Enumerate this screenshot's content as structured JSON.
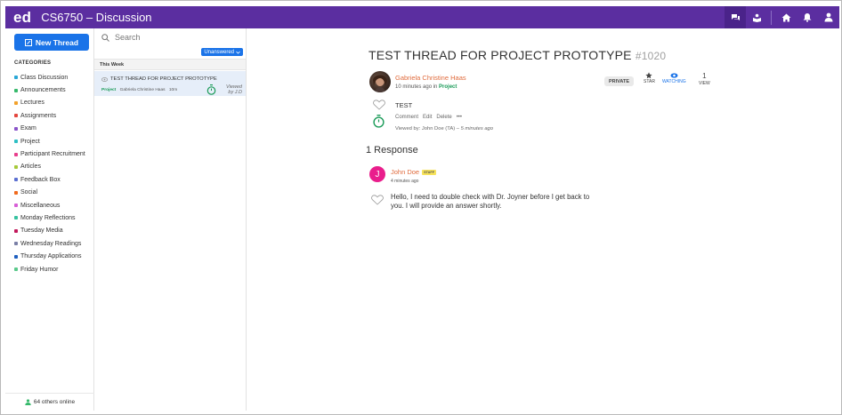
{
  "app": {
    "logo": "ed",
    "course_title": "CS6750 – Discussion"
  },
  "topbar_icons": [
    "discussion-icon",
    "lessons-icon",
    "home-icon",
    "notifications-icon",
    "account-icon"
  ],
  "sidebar": {
    "new_thread_label": "New Thread",
    "categories_heading": "CATEGORIES",
    "categories": [
      {
        "label": "Class Discussion",
        "color": "#2aa7d6"
      },
      {
        "label": "Announcements",
        "color": "#36b96b"
      },
      {
        "label": "Lectures",
        "color": "#f2a12b"
      },
      {
        "label": "Assignments",
        "color": "#e4463d"
      },
      {
        "label": "Exam",
        "color": "#8a54c9"
      },
      {
        "label": "Project",
        "color": "#2ebfc4"
      },
      {
        "label": "Participant Recruitment",
        "color": "#e83e8c"
      },
      {
        "label": "Articles",
        "color": "#a6c93a"
      },
      {
        "label": "Feedback Box",
        "color": "#5b6fd1"
      },
      {
        "label": "Social",
        "color": "#f06a1d"
      },
      {
        "label": "Miscellaneous",
        "color": "#d75fd6"
      },
      {
        "label": "Monday Reflections",
        "color": "#36c2a0"
      },
      {
        "label": "Tuesday Media",
        "color": "#c2185b"
      },
      {
        "label": "Wednesday Readings",
        "color": "#7a7fa6"
      },
      {
        "label": "Thursday Applications",
        "color": "#1f5fbf"
      },
      {
        "label": "Friday Humor",
        "color": "#5bc98b"
      }
    ],
    "online_text": "64 others online"
  },
  "thread_list": {
    "search_placeholder": "Search",
    "filter_label": "Unanswered",
    "week_header": "This Week",
    "threads": [
      {
        "title": "TEST THREAD FOR PROJECT PROTOTYPE",
        "category": "Project",
        "author": "Gabriela Christine Haas",
        "age": "10m",
        "viewed_line1": "Viewed",
        "viewed_line2": "by J.D"
      }
    ]
  },
  "post": {
    "title": "TEST THREAD FOR PROJECT PROTOTYPE",
    "number": "#1020",
    "author": "Gabriela Christine Haas",
    "time_prefix": "10 minutes ago in",
    "category": "Project",
    "private_label": "PRIVATE",
    "star_label": "STAR",
    "watching_label": "WATCHING",
    "view_count": "1",
    "view_label": "VIEW",
    "body": "TEST",
    "actions": [
      "Comment",
      "Edit",
      "Delete",
      "•••"
    ],
    "viewed_by_prefix": "Viewed by: John Doe (TA) –",
    "viewed_by_time": "5 minutes ago"
  },
  "responses": {
    "heading": "1 Response",
    "items": [
      {
        "avatar_letter": "J",
        "avatar_color": "#e91e8c",
        "author": "John Doe",
        "badge": "STAFF",
        "time": "4 minutes ago",
        "text": "Hello, I need to double check with Dr. Joyner before I get back to you. I will provide an answer shortly."
      }
    ]
  }
}
